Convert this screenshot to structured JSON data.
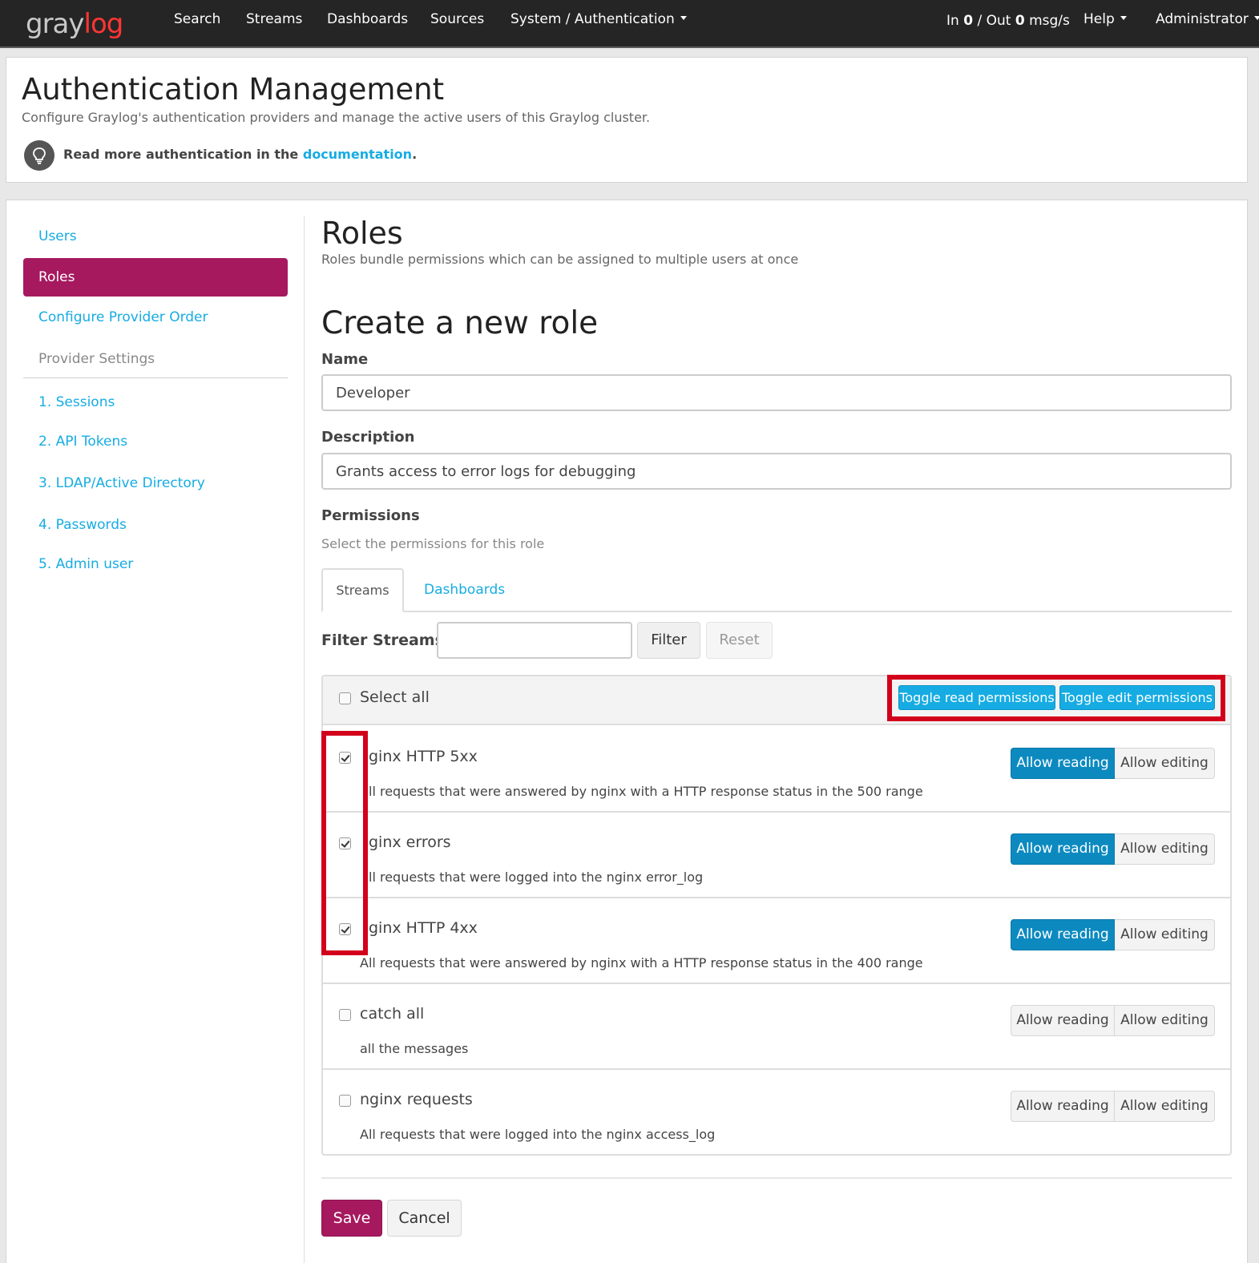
{
  "nav": {
    "logo_part1": "gray",
    "logo_part2": "log",
    "items": [
      "Search",
      "Streams",
      "Dashboards",
      "Sources",
      "System / Authentication"
    ],
    "throughput_in_label": "In",
    "throughput_in": "0",
    "throughput_out_label": "/ Out",
    "throughput_out": "0",
    "throughput_unit": "msg/s",
    "help": "Help",
    "user": "Administrator"
  },
  "header": {
    "title": "Authentication Management",
    "subtitle": "Configure Graylog's authentication providers and manage the active users of this Graylog cluster.",
    "tip_prefix": "Read more authentication in the",
    "tip_link": "documentation",
    "tip_suffix": "."
  },
  "sidebar": {
    "users": "Users",
    "roles": "Roles",
    "provider_order": "Configure Provider Order",
    "provider_settings": "Provider Settings",
    "providers": [
      "1. Sessions",
      "2. API Tokens",
      "3. LDAP/Active Directory",
      "4. Passwords",
      "5. Admin user"
    ]
  },
  "roles": {
    "title": "Roles",
    "subtitle": "Roles bundle permissions which can be assigned to multiple users at once",
    "create_title": "Create a new role",
    "name_label": "Name",
    "name_value": "Developer",
    "description_label": "Description",
    "description_value": "Grants access to error logs for debugging",
    "permissions_label": "Permissions",
    "permissions_sub": "Select the permissions for this role",
    "tabs": [
      "Streams",
      "Dashboards"
    ],
    "filter_label": "Filter Streams",
    "filter_value": "",
    "filter_button": "Filter",
    "reset_button": "Reset",
    "select_all": "Select all",
    "toggle_read": "Toggle read permissions",
    "toggle_edit": "Toggle edit permissions",
    "allow_reading": "Allow reading",
    "allow_editing": "Allow editing",
    "streams": [
      {
        "title": "ginx HTTP 5xx",
        "description": "ll requests that were answered by nginx with a HTTP response status in the 500 range",
        "checked": true,
        "read": true
      },
      {
        "title": "ginx errors",
        "description": "ll requests that were logged into the nginx error_log",
        "checked": true,
        "read": true
      },
      {
        "title": "ginx HTTP 4xx",
        "description": "All requests that were answered by nginx with a HTTP response status in the 400 range",
        "checked": true,
        "read": true
      },
      {
        "title": "catch all",
        "description": "all the messages",
        "checked": false,
        "read": false
      },
      {
        "title": "nginx requests",
        "description": "All requests that were logged into the nginx access_log",
        "checked": false,
        "read": false
      }
    ],
    "save_button": "Save",
    "cancel_button": "Cancel"
  },
  "colors": {
    "brand_magenta": "#a6195f",
    "link_blue": "#16ace3",
    "active_blue": "#0c8ac0",
    "highlight_red": "#d3001b",
    "navbar": "#252525"
  }
}
